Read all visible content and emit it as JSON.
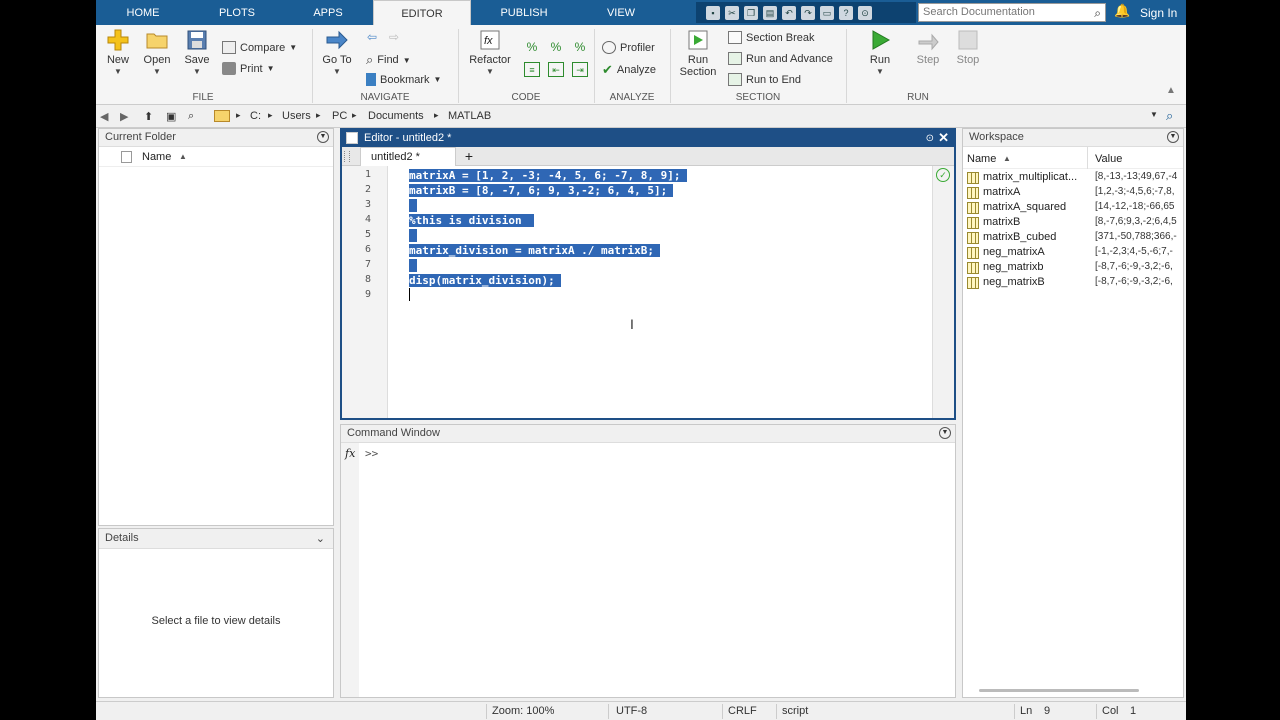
{
  "tabs": {
    "home": "HOME",
    "plots": "PLOTS",
    "apps": "APPS",
    "editor": "EDITOR",
    "publish": "PUBLISH",
    "view": "VIEW"
  },
  "search": {
    "placeholder": "Search Documentation"
  },
  "signin": "Sign In",
  "toolstrip": {
    "file": {
      "label": "FILE",
      "new": "New",
      "open": "Open",
      "save": "Save",
      "compare": "Compare",
      "print": "Print"
    },
    "navigate": {
      "label": "NAVIGATE",
      "goto": "Go To",
      "find": "Find",
      "bookmark": "Bookmark"
    },
    "code": {
      "label": "CODE",
      "refactor": "Refactor"
    },
    "analyze": {
      "label": "ANALYZE",
      "profiler": "Profiler",
      "analyze": "Analyze"
    },
    "section": {
      "label": "SECTION",
      "run_section_1": "Run",
      "run_section_2": "Section",
      "section_break": "Section Break",
      "run_and_advance": "Run and Advance",
      "run_to_end": "Run to End"
    },
    "run": {
      "label": "RUN",
      "run": "Run",
      "step": "Step",
      "stop": "Stop"
    }
  },
  "address": {
    "drive": "C:",
    "parts": [
      "Users",
      "PC",
      "Documents",
      "MATLAB"
    ]
  },
  "current_folder": {
    "title": "Current Folder",
    "name_header": "Name"
  },
  "details": {
    "title": "Details",
    "empty_text": "Select a file to view details"
  },
  "editor": {
    "title": "Editor - untitled2 *",
    "tab": "untitled2 *",
    "add_tab": "+",
    "line_numbers": [
      "1",
      "2",
      "3",
      "4",
      "5",
      "6",
      "7",
      "8",
      "9"
    ],
    "lines": [
      "matrixA = [1, 2, -3; -4, 5, 6; -7, 8, 9];",
      "matrixB = [8, -7, 6; 9, 3,-2; 6, 4, 5];",
      " ",
      "%this is division ",
      " ",
      "matrix_division = matrixA ./ matrixB;",
      " ",
      "disp(matrix_division);"
    ]
  },
  "command_window": {
    "title": "Command Window",
    "fx": "fx",
    "prompt": ">>"
  },
  "workspace": {
    "title": "Workspace",
    "name_header": "Name",
    "value_header": "Value",
    "rows": [
      {
        "name": "matrix_multiplicat...",
        "value": "[8,-13,-13;49,67,-4"
      },
      {
        "name": "matrixA",
        "value": "[1,2,-3;-4,5,6;-7,8,"
      },
      {
        "name": "matrixA_squared",
        "value": "[14,-12,-18;-66,65"
      },
      {
        "name": "matrixB",
        "value": "[8,-7,6;9,3,-2;6,4,5"
      },
      {
        "name": "matrixB_cubed",
        "value": "[371,-50,788;366,-"
      },
      {
        "name": "neg_matrixA",
        "value": "[-1,-2,3;4,-5,-6;7,-"
      },
      {
        "name": "neg_matrixb",
        "value": "[-8,7,-6;-9,-3,2;-6,"
      },
      {
        "name": "neg_matrixB",
        "value": "[-8,7,-6;-9,-3,2;-6,"
      }
    ]
  },
  "statusbar": {
    "zoom": "Zoom: 100%",
    "encoding": "UTF-8",
    "eol": "CRLF",
    "type": "script",
    "ln_label": "Ln",
    "ln": "9",
    "col_label": "Col",
    "col": "1"
  },
  "colors": {
    "tabstrip": "#1a5d95",
    "editor_title": "#1e4f86",
    "selection": "#2f67b5",
    "run_green": "#3aaa35"
  }
}
